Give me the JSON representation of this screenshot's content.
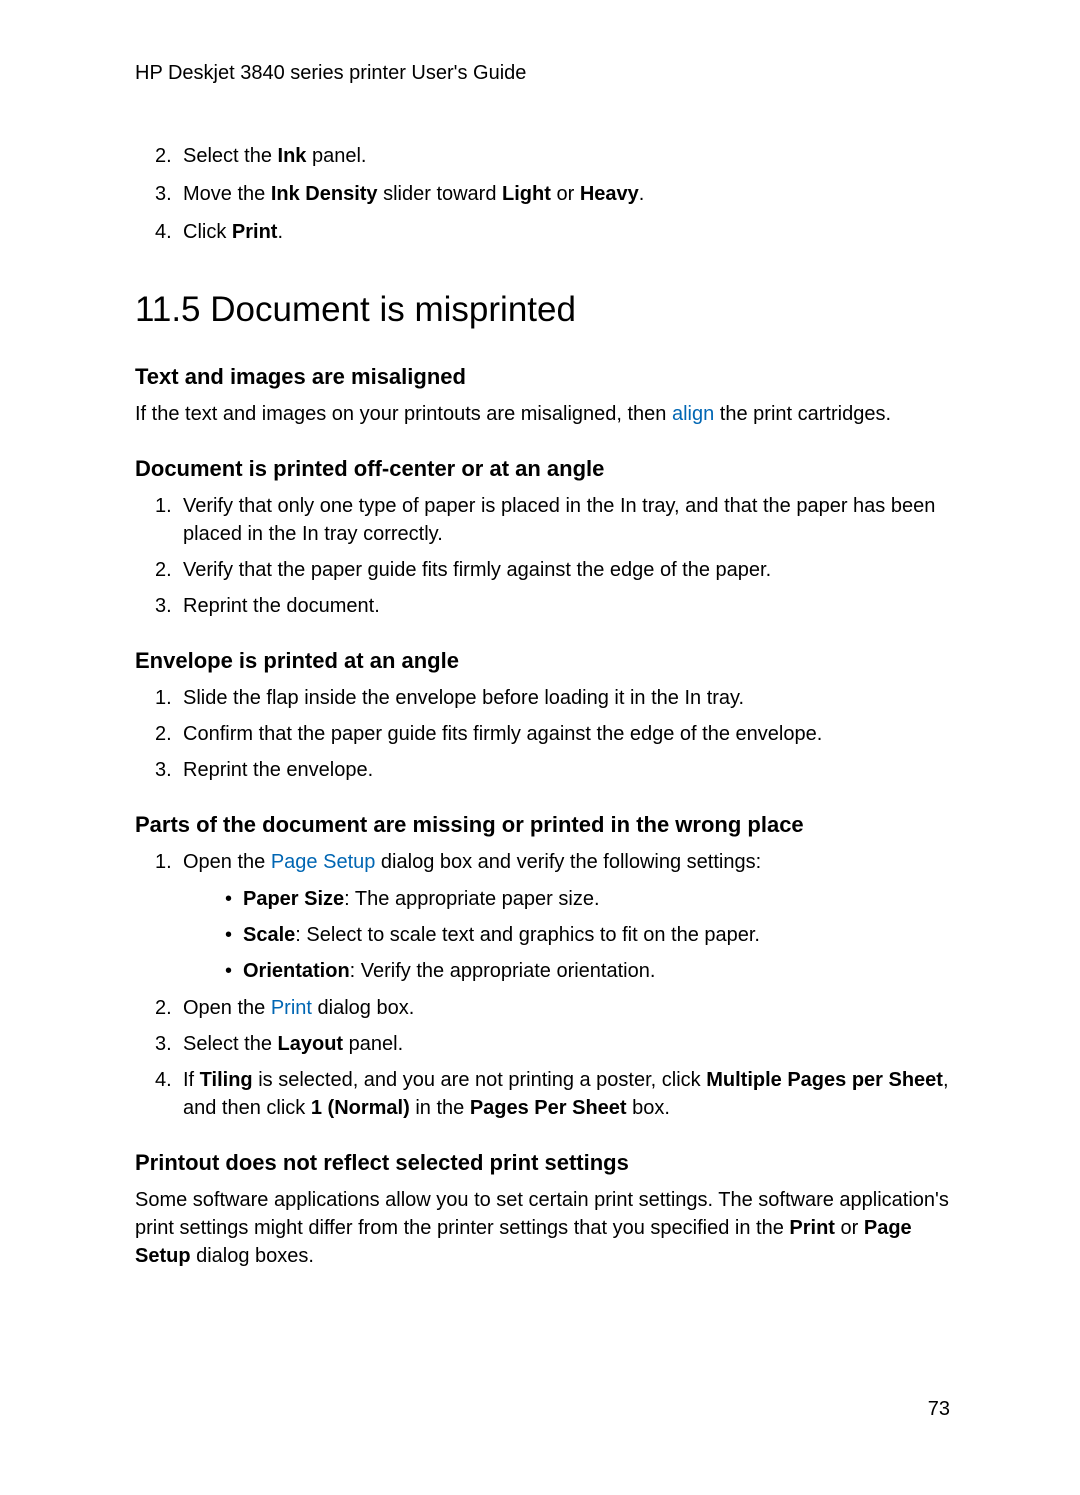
{
  "header": "HP Deskjet 3840 series printer User's Guide",
  "topList": {
    "item2": {
      "num": "2.",
      "pre": "Select the ",
      "bold": "Ink",
      "post": " panel."
    },
    "item3": {
      "num": "3.",
      "pre": "Move the ",
      "bold1": "Ink Density",
      "mid": " slider toward ",
      "bold2": "Light",
      "mid2": " or ",
      "bold3": "Heavy",
      "post": "."
    },
    "item4": {
      "num": "4.",
      "pre": "Click ",
      "bold": "Print",
      "post": "."
    }
  },
  "h1": "11.5  Document is misprinted",
  "section1": {
    "title": "Text and images are misaligned",
    "para_pre": "If the text and images on your printouts are misaligned, then ",
    "para_link": "align",
    "para_post": " the print cartridges."
  },
  "section2": {
    "title": "Document is printed off-center or at an angle",
    "item1": {
      "num": "1.",
      "text": "Verify that only one type of paper is placed in the In tray, and that the paper has been placed in the In tray correctly."
    },
    "item2": {
      "num": "2.",
      "text": "Verify that the paper guide fits firmly against the edge of the paper."
    },
    "item3": {
      "num": "3.",
      "text": "Reprint the document."
    }
  },
  "section3": {
    "title": "Envelope is printed at an angle",
    "item1": {
      "num": "1.",
      "text": "Slide the flap inside the envelope before loading it in the In tray."
    },
    "item2": {
      "num": "2.",
      "text": "Confirm that the paper guide fits firmly against the edge of the envelope."
    },
    "item3": {
      "num": "3.",
      "text": "Reprint the envelope."
    }
  },
  "section4": {
    "title": "Parts of the document are missing or printed in the wrong place",
    "item1": {
      "num": "1.",
      "pre": "Open the ",
      "link": "Page Setup",
      "post": " dialog box and verify the following settings:"
    },
    "bullet1": {
      "bold": "Paper Size",
      "post": ": The appropriate paper size."
    },
    "bullet2": {
      "bold": "Scale",
      "post": ": Select to scale text and graphics to fit on the paper."
    },
    "bullet3": {
      "bold": "Orientation",
      "post": ": Verify the appropriate orientation."
    },
    "item2": {
      "num": "2.",
      "pre": "Open the ",
      "link": "Print",
      "post": " dialog box."
    },
    "item3": {
      "num": "3.",
      "pre": "Select the ",
      "bold": "Layout",
      "post": " panel."
    },
    "item4": {
      "num": "4.",
      "pre": "If ",
      "bold1": "Tiling",
      "mid1": " is selected, and you are not printing a poster, click ",
      "bold2": "Multiple Pages per Sheet",
      "mid2": ", and then click ",
      "bold3": "1 (Normal)",
      "mid3": " in the ",
      "bold4": "Pages Per Sheet",
      "post": " box."
    }
  },
  "section5": {
    "title": "Printout does not reflect selected print settings",
    "para_pre": "Some software applications allow you to set certain print settings. The software application's print settings might differ from the printer settings that you specified in the ",
    "bold1": "Print",
    "mid": " or ",
    "bold2": "Page Setup",
    "post": " dialog boxes."
  },
  "pageNumber": "73"
}
